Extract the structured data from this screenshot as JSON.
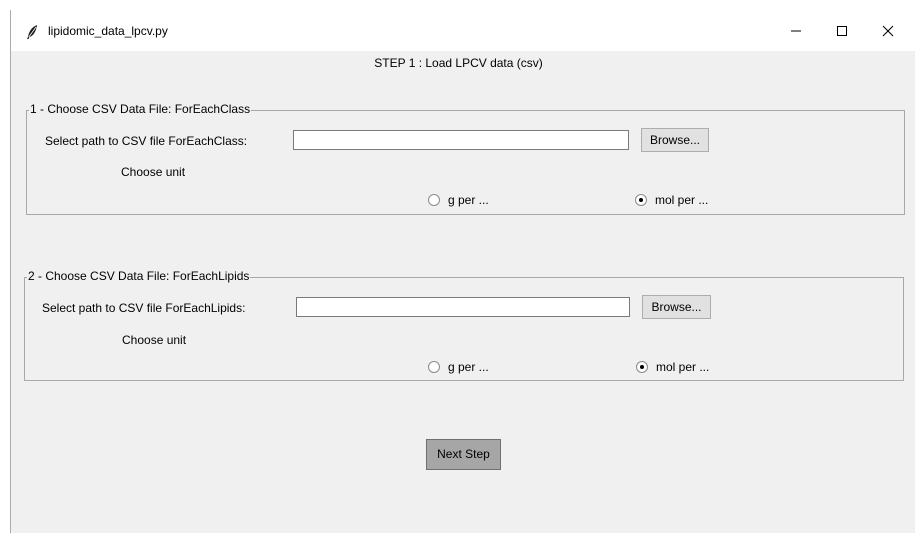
{
  "window": {
    "title": "lipidomic_data_lpcv.py",
    "icon": "feather-icon",
    "controls": [
      "minimize-icon",
      "maximize-icon",
      "close-icon"
    ]
  },
  "step_title": "STEP 1 : Load LPCV data (csv)",
  "section1": {
    "legend": "1 - Choose CSV Data File: ForEachClass",
    "path_label": "Select path to CSV file ForEachClass:",
    "path_value": "",
    "browse_label": "Browse...",
    "unit_label": "Choose unit",
    "options": [
      "g per ...",
      "mol per ..."
    ],
    "selected": "mol per ..."
  },
  "section2": {
    "legend": "2 - Choose CSV Data File: ForEachLipids",
    "path_label": "Select path to CSV file ForEachLipids:",
    "path_value": "",
    "browse_label": "Browse...",
    "unit_label": "Choose unit",
    "options": [
      "g per ...",
      "mol per ..."
    ],
    "selected": "mol per ..."
  },
  "next_label": "Next Step"
}
